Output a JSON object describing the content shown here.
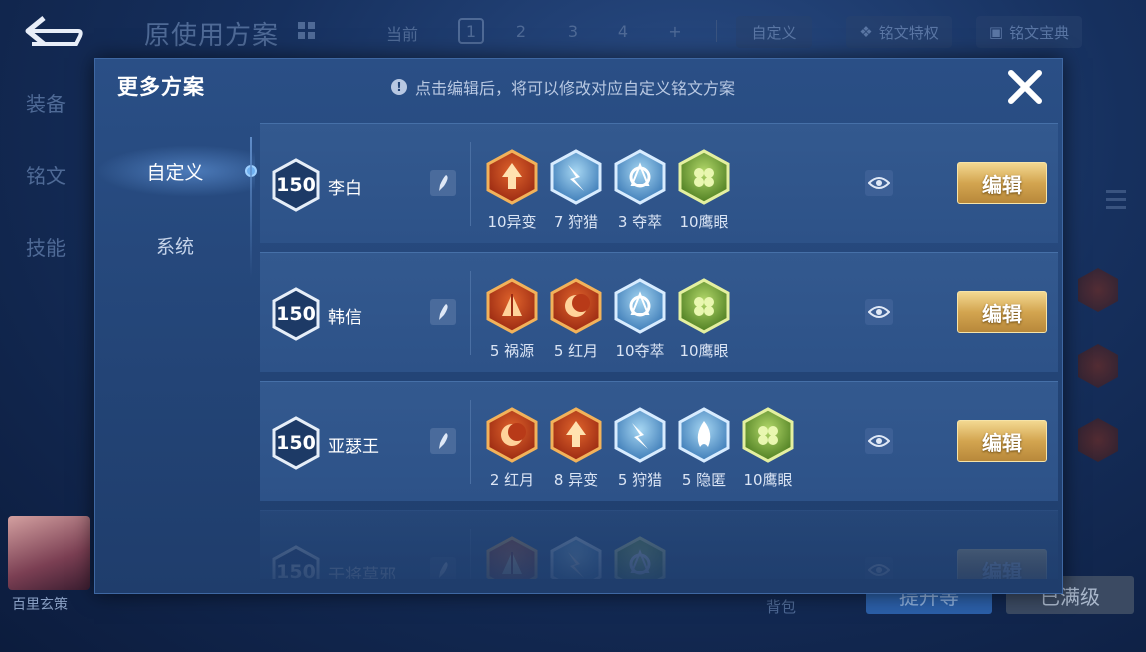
{
  "background": {
    "title": "原使用方案",
    "current_label": "当前",
    "pages": [
      "1",
      "2",
      "3",
      "4",
      "+"
    ],
    "selected_page": "1",
    "custom_label": "自定义",
    "privilege_label": "铭文特权",
    "dictionary_label": "铭文宝典",
    "side_items": [
      "装备",
      "铭文",
      "技能"
    ],
    "avatar_name": "百里玄策",
    "backpack_label": "背包",
    "upgrade_label": "提升等",
    "max_level_label": "已满级"
  },
  "modal": {
    "title": "更多方案",
    "hint": "点击编辑后，将可以修改对应自定义铭文方案",
    "tabs": [
      {
        "label": "自定义",
        "active": true
      },
      {
        "label": "系统",
        "active": false
      }
    ],
    "rows": [
      {
        "level": "150",
        "hero": "李白",
        "edit_label": "编辑",
        "runes": [
          {
            "label": "10异变",
            "color": "red",
            "icon": "arrow-up-rune-icon"
          },
          {
            "label": "7 狩猎",
            "color": "blue",
            "icon": "lightning-rune-icon"
          },
          {
            "label": "3 夺萃",
            "color": "blue",
            "icon": "knot-rune-icon"
          },
          {
            "label": "10鹰眼",
            "color": "green",
            "icon": "clover-rune-icon"
          }
        ]
      },
      {
        "level": "150",
        "hero": "韩信",
        "edit_label": "编辑",
        "runes": [
          {
            "label": "5 祸源",
            "color": "red",
            "icon": "fan-rune-icon"
          },
          {
            "label": "5 红月",
            "color": "red",
            "icon": "crescent-rune-icon"
          },
          {
            "label": "10夺萃",
            "color": "blue",
            "icon": "knot-rune-icon"
          },
          {
            "label": "10鹰眼",
            "color": "green",
            "icon": "clover-rune-icon"
          }
        ]
      },
      {
        "level": "150",
        "hero": "亚瑟王",
        "edit_label": "编辑",
        "runes": [
          {
            "label": "2 红月",
            "color": "red",
            "icon": "crescent-rune-icon"
          },
          {
            "label": "8 异变",
            "color": "red",
            "icon": "arrow-up-rune-icon"
          },
          {
            "label": "5 狩猎",
            "color": "blue",
            "icon": "lightning-rune-icon"
          },
          {
            "label": "5 隐匿",
            "color": "blue",
            "icon": "flame-rune-icon"
          },
          {
            "label": "10鹰眼",
            "color": "green",
            "icon": "clover-rune-icon"
          }
        ]
      },
      {
        "level": "150",
        "hero": "干将莫邪",
        "edit_label": "编辑",
        "runes": [
          {
            "label": "",
            "color": "red",
            "icon": "fan-rune-icon"
          },
          {
            "label": "",
            "color": "blue",
            "icon": "lightning-rune-icon"
          },
          {
            "label": "",
            "color": "green",
            "icon": "knot-rune-icon"
          }
        ]
      }
    ]
  },
  "colors": {
    "accent_gold": "#d3a550",
    "rune_red": "#c8401e",
    "rune_blue": "#5aa0d8",
    "rune_green": "#78b040"
  }
}
